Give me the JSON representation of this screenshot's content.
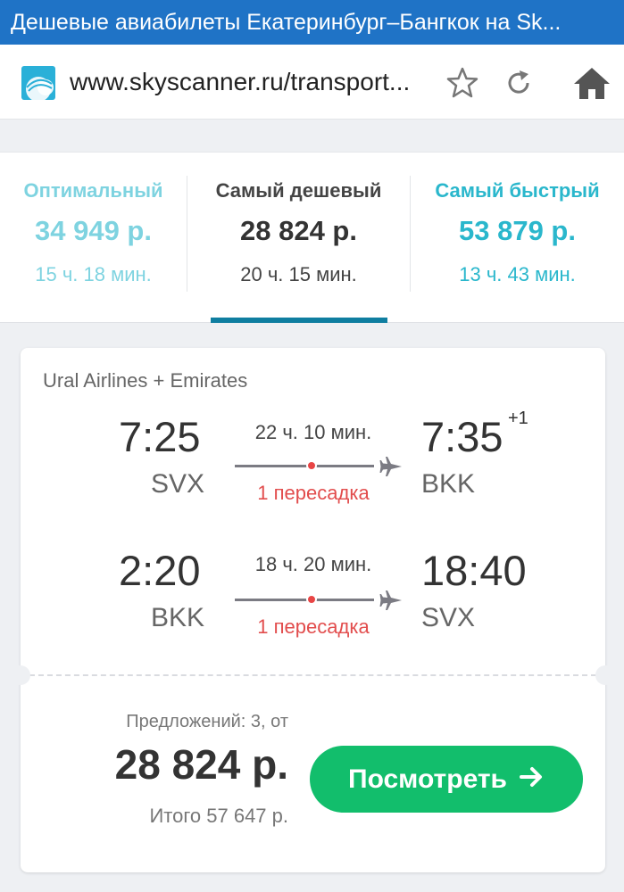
{
  "titlebar": {
    "title": "Дешевые авиабилеты Екатеринбург–Бангкок на Sk..."
  },
  "urlbar": {
    "url": "www.skyscanner.ru/transport...",
    "site_icon": "skyscanner-cloud-icon",
    "bookmark_icon": "star-icon",
    "reload_icon": "reload-icon",
    "home_icon": "home-icon"
  },
  "tabs": [
    {
      "title": "Оптимальный",
      "price": "34 949 р.",
      "duration": "15 ч. 18 мин."
    },
    {
      "title": "Самый дешевый",
      "price": "28 824 р.",
      "duration": "20 ч. 15 мин."
    },
    {
      "title": "Самый быстрый",
      "price": "53 879 р.",
      "duration": "13 ч. 43 мин."
    }
  ],
  "active_tab": 1,
  "colors": {
    "accent": "#0f7ea0",
    "teal": "#2ab7cc",
    "brand_blue": "#1f73c6",
    "cta_green": "#12be6c",
    "stop_red": "#e24d4d"
  },
  "result": {
    "airline": "Ural Airlines + Emirates",
    "outbound": {
      "dep_time": "7:25",
      "dep_code": "SVX",
      "duration": "22 ч. 10 мин.",
      "stops": "1 пересадка",
      "arr_time": "7:35",
      "arr_plus": "+1",
      "arr_code": "BKK"
    },
    "inbound": {
      "dep_time": "2:20",
      "dep_code": "BKK",
      "duration": "18 ч. 20 мин.",
      "stops": "1 пересадка",
      "arr_time": "18:40",
      "arr_code": "SVX"
    },
    "offers": "Предложений: 3, от",
    "price": "28 824 р.",
    "total": "Итого 57 647 р.",
    "button": "Посмотреть",
    "button_icon": "arrow-right-icon"
  }
}
